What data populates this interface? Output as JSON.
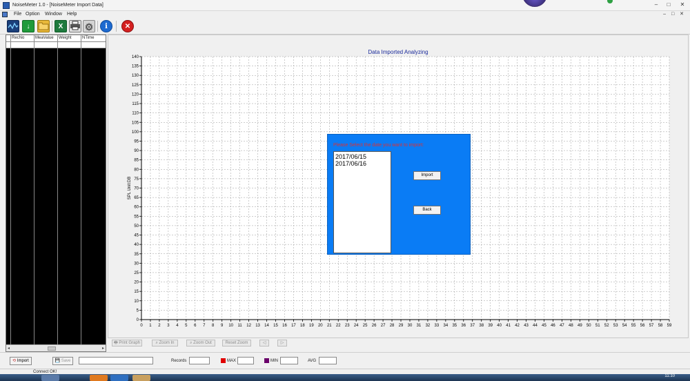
{
  "window": {
    "title": "NoiseMeter 1.0  - [NoiseMeter Import Data]",
    "minimize": "–",
    "maximize": "□",
    "close": "✕",
    "mdi_controls": "– □ ✕"
  },
  "menu": [
    "File",
    "Option",
    "Window",
    "Help"
  ],
  "toolbar": {
    "icons": [
      "monitor-icon",
      "download-icon",
      "open-folder-icon",
      "excel-icon",
      "print-icon",
      "settings-gear-icon",
      "info-icon",
      "exit-icon"
    ],
    "excel_glyph": "X",
    "info_glyph": "i",
    "exit_glyph": "✕",
    "download_glyph": "↓",
    "settings_glyph": "⚙"
  },
  "records_table": {
    "columns": [
      "RecNo",
      "MeaValue",
      "Weight",
      "NTime"
    ],
    "scroll_left": "◂",
    "scroll_right": "▸"
  },
  "chart_data": {
    "type": "line",
    "title": "Data Imported  Analyzing",
    "xlabel": "",
    "ylabel": "SPL  Unit:DB",
    "xlim": [
      0,
      59
    ],
    "ylim": [
      0,
      140
    ],
    "x_ticks": [
      0,
      1,
      2,
      3,
      4,
      5,
      6,
      7,
      8,
      9,
      10,
      11,
      12,
      13,
      14,
      15,
      16,
      17,
      18,
      19,
      20,
      21,
      22,
      23,
      24,
      25,
      26,
      27,
      28,
      29,
      30,
      31,
      32,
      33,
      34,
      35,
      36,
      37,
      38,
      39,
      40,
      41,
      42,
      43,
      44,
      45,
      46,
      47,
      48,
      49,
      50,
      51,
      52,
      53,
      54,
      55,
      56,
      57,
      58,
      59
    ],
    "y_ticks": [
      0,
      5,
      10,
      15,
      20,
      25,
      30,
      35,
      40,
      45,
      50,
      55,
      60,
      65,
      70,
      75,
      80,
      85,
      90,
      95,
      100,
      105,
      110,
      115,
      120,
      125,
      130,
      135,
      140
    ],
    "grid": true,
    "series": [],
    "colors": {
      "title": "#1a2a9a",
      "grid": "#9a9a9a",
      "axis": "#000000",
      "background": "#ffffff"
    }
  },
  "import_dialog": {
    "prompt": "Please Select the date you want to import:",
    "dates": [
      "2017/06/15",
      "2017/06/16"
    ],
    "import_label": "Import",
    "back_label": "Back",
    "background": "#0a7cf5"
  },
  "chart_toolbar": {
    "print_graph": "Print Graph",
    "zoom_in": "Zoom In",
    "zoom_out": "Zoom Out",
    "reset_zoom": "Reset Zoom",
    "prev": "◁",
    "next": "▷"
  },
  "bottom": {
    "import_label": "Import",
    "save_label": "Save",
    "records_label": "Records",
    "max_label": "MAX",
    "min_label": "MIN",
    "avg_label": "AVG",
    "max_color": "#e00000",
    "min_color": "#6a006a"
  },
  "status": {
    "message": "Connect OK!"
  },
  "taskbar": {
    "time": "11:10"
  }
}
